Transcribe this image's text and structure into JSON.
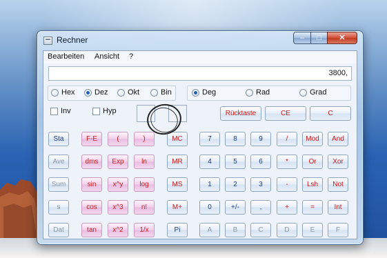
{
  "window": {
    "title": "Rechner",
    "caption": {
      "minimize": "–",
      "maximize": "□",
      "close": "✕"
    }
  },
  "menu": {
    "items": [
      "Bearbeiten",
      "Ansicht",
      "?"
    ]
  },
  "display": {
    "value": "3800,"
  },
  "number_system": {
    "options": [
      "Hex",
      "Dez",
      "Okt",
      "Bin"
    ],
    "selected": "Dez"
  },
  "angle_units": {
    "options": [
      "Deg",
      "Rad",
      "Grad"
    ],
    "selected": "Deg"
  },
  "checkboxes": {
    "inv": "Inv",
    "hyp": "Hyp"
  },
  "top_buttons": {
    "backspace": "Rücktaste",
    "ce": "CE",
    "c": "C"
  },
  "stat_buttons": [
    "Sta",
    "Ave",
    "Sum",
    "s",
    "Dat"
  ],
  "function_rows": [
    [
      "F-E",
      "(",
      ")"
    ],
    [
      "dms",
      "Exp",
      "ln"
    ],
    [
      "sin",
      "x^y",
      "log"
    ],
    [
      "cos",
      "x^3",
      "n!"
    ],
    [
      "tan",
      "x^2",
      "1/x"
    ]
  ],
  "memory_buttons": [
    "MC",
    "MR",
    "MS",
    "M+",
    "Pi"
  ],
  "keypad_rows": [
    [
      "7",
      "8",
      "9",
      "/",
      "Mod",
      "And"
    ],
    [
      "4",
      "5",
      "6",
      "*",
      "Or",
      "Xor"
    ],
    [
      "1",
      "2",
      "3",
      "-",
      "Lsh",
      "Not"
    ],
    [
      "0",
      "+/-",
      ",",
      "+",
      "=",
      "Int"
    ],
    [
      "A",
      "B",
      "C",
      "D",
      "E",
      "F"
    ]
  ]
}
